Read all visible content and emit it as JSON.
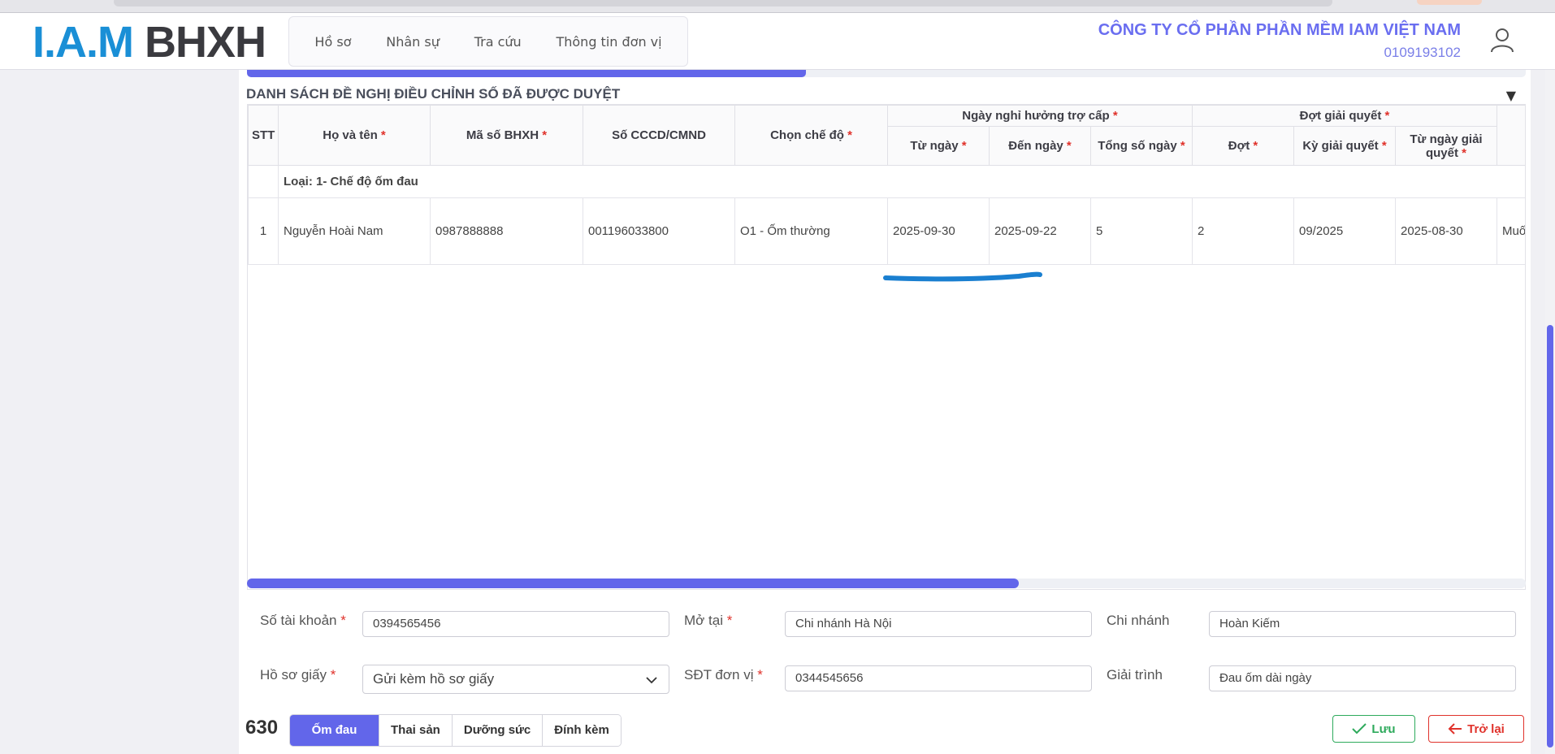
{
  "header": {
    "logo_iam": "I.A.M",
    "logo_bhxh": "BHXH",
    "nav": [
      "Hồ sơ",
      "Nhân sự",
      "Tra cứu",
      "Thông tin đơn vị"
    ],
    "company_name": "CÔNG TY CỔ PHẦN PHẦN MỀM IAM VIỆT NAM",
    "company_tax": "0109193102"
  },
  "section": {
    "title": "DANH SÁCH ĐỀ NGHỊ ĐIỀU CHỈNH SỐ ĐÃ ĐƯỢC DUYỆT",
    "collapse_symbol": "▼"
  },
  "table": {
    "headers": {
      "stt": "STT",
      "ho_ten": "Họ và tên",
      "ma_so_bhxh": "Mã số BHXH",
      "so_cccd": "Số CCCD/CMND",
      "che_do": "Chọn chế độ",
      "group_nghi": "Ngày nghỉ hưởng trợ cấp",
      "tu_ngay": "Từ ngày",
      "den_ngay": "Đến ngày",
      "tong_so_ngay": "Tổng số ngày",
      "group_dot": "Đợt giải quyết",
      "dot": "Đợt",
      "ky_giai_quyet": "Kỳ giải quyết",
      "tu_ngay_giai_quyet": "Từ ngày giải quyết",
      "required_mark": "*"
    },
    "group_label": "Loại: 1- Chế độ ốm đau",
    "rows": [
      {
        "stt": "1",
        "ho_ten": "Nguyễn Hoài Nam",
        "ma_so_bhxh": "0987888888",
        "so_cccd": "001196033800",
        "che_do": "O1 - Ốm thường",
        "tu_ngay": "2025-09-30",
        "den_ngay": "2025-09-22",
        "tong_so_ngay": "5",
        "dot": "2",
        "ky_giai_quyet": "09/2025",
        "tu_ngay_giai_quyet": "2025-08-30",
        "extra": "Muốn"
      }
    ]
  },
  "form": {
    "so_tai_khoan_label": "Số tài khoản",
    "so_tai_khoan_value": "0394565456",
    "mo_tai_label": "Mở tại",
    "mo_tai_value": "Chi nhánh Hà Nội",
    "chi_nhanh_label": "Chi nhánh",
    "chi_nhanh_value": "Hoàn Kiếm",
    "ho_so_giay_label": "Hồ sơ giấy",
    "ho_so_giay_value": "Gửi kèm hồ sơ giấy",
    "sdt_label": "SĐT đơn vị",
    "sdt_value": "0344545656",
    "giai_trinh_label": "Giải trình",
    "giai_trinh_value": "Đau ốm dài ngày",
    "required_mark": "*"
  },
  "footer": {
    "counter": "630",
    "tabs": [
      "Ốm đau",
      "Thai sản",
      "Dưỡng sức",
      "Đính kèm"
    ],
    "save_label": "Lưu",
    "back_label": "Trở lại"
  },
  "colors": {
    "accent": "#6266ea",
    "required": "#e0322b",
    "save": "#2eaa5c",
    "back": "#e0322b",
    "company": "#6a6ef0"
  }
}
